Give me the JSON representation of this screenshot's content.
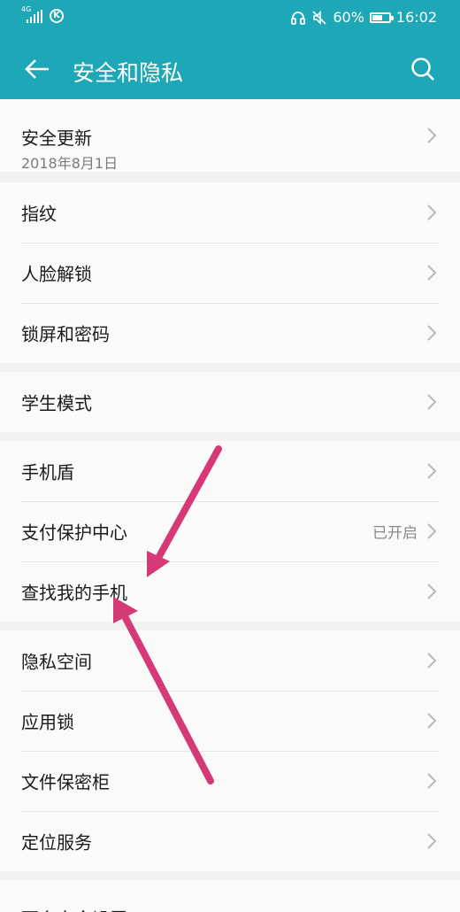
{
  "status_bar": {
    "network": "4G",
    "k_icon": "K",
    "battery_percent": "60%",
    "battery_level": 0.6,
    "time": "16:02",
    "icons": [
      "headphone-icon",
      "mute-icon",
      "battery-icon"
    ]
  },
  "header": {
    "title": "安全和隐私",
    "back_icon": "arrow-left-icon",
    "search_icon": "search-icon",
    "background": "#1ea7b7"
  },
  "groups": [
    {
      "items": [
        {
          "label": "安全更新",
          "subtitle": "2018年8月1日"
        }
      ]
    },
    {
      "items": [
        {
          "label": "指纹"
        },
        {
          "label": "人脸解锁"
        },
        {
          "label": "锁屏和密码"
        }
      ]
    },
    {
      "items": [
        {
          "label": "学生模式"
        }
      ]
    },
    {
      "items": [
        {
          "label": "手机盾"
        },
        {
          "label": "支付保护中心",
          "status": "已开启"
        },
        {
          "label": "查找我的手机"
        }
      ]
    },
    {
      "items": [
        {
          "label": "隐私空间"
        },
        {
          "label": "应用锁"
        },
        {
          "label": "文件保密柜"
        },
        {
          "label": "定位服务"
        }
      ]
    },
    {
      "items": [
        {
          "label": "更多安全设置"
        }
      ]
    }
  ],
  "annotation_color": "#d63a76"
}
